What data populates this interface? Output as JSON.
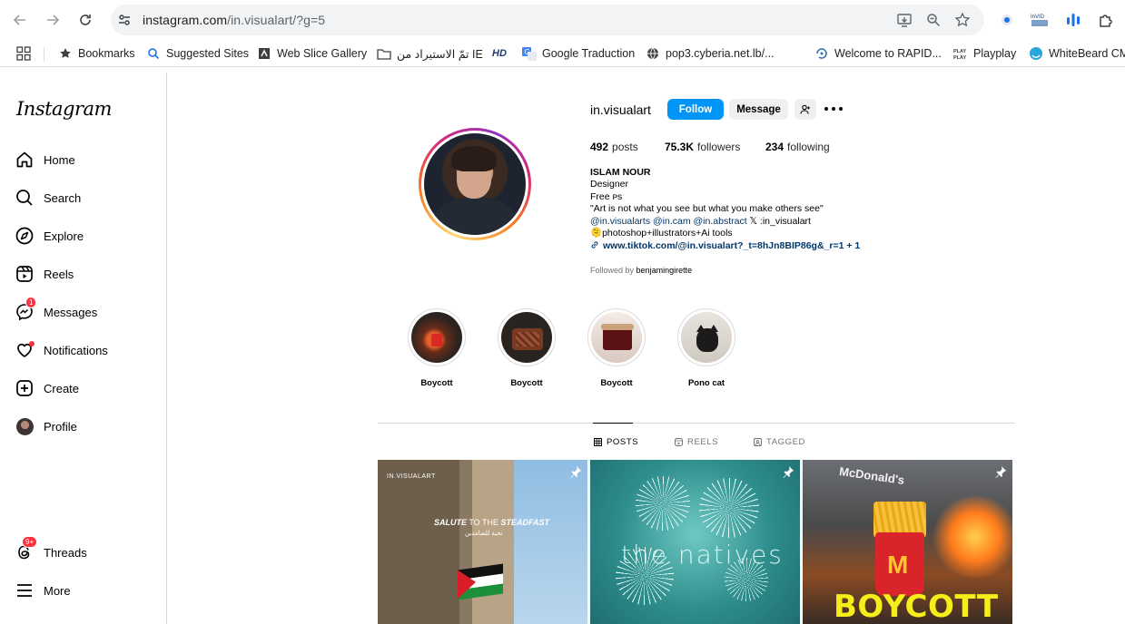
{
  "browser": {
    "url_host": "instagram.com",
    "url_path": "/in.visualart/?g=5"
  },
  "bookmarks": [
    {
      "label": "Bookmarks",
      "icon": "star-icon"
    },
    {
      "label": "Suggested Sites",
      "icon": "search-icon"
    },
    {
      "label": "Web Slice Gallery",
      "icon": "web-slice-icon"
    },
    {
      "label": "تمّ الاستيراد من IE",
      "icon": "folder-icon"
    },
    {
      "label": "HD",
      "icon": "hd-icon"
    },
    {
      "label": "Google Traduction",
      "icon": "translate-icon"
    },
    {
      "label": "pop3.cyberia.net.lb/...",
      "icon": "globe-icon"
    },
    {
      "label": "Welcome to RAPID...",
      "icon": "rapid-icon"
    },
    {
      "label": "Playplay",
      "icon": "playplay-icon"
    },
    {
      "label": "WhiteBeard CM",
      "icon": "whitebeard-icon"
    }
  ],
  "sidebar": {
    "logo": "Instagram",
    "items": [
      {
        "label": "Home",
        "icon": "home-icon"
      },
      {
        "label": "Search",
        "icon": "search-icon"
      },
      {
        "label": "Explore",
        "icon": "compass-icon"
      },
      {
        "label": "Reels",
        "icon": "reels-icon"
      },
      {
        "label": "Messages",
        "icon": "messenger-icon",
        "badge": "1"
      },
      {
        "label": "Notifications",
        "icon": "heart-icon"
      },
      {
        "label": "Create",
        "icon": "plus-square-icon"
      },
      {
        "label": "Profile",
        "icon": "avatar"
      },
      {
        "label": "Threads",
        "icon": "threads-icon",
        "badge": "9+"
      },
      {
        "label": "More",
        "icon": "hamburger-icon"
      }
    ]
  },
  "profile": {
    "username": "in.visualart",
    "follow_label": "Follow",
    "message_label": "Message",
    "stats": {
      "posts_count": "492",
      "posts_label": "posts",
      "followers_count": "75.3K",
      "followers_label": "followers",
      "following_count": "234",
      "following_label": "following"
    },
    "name": "ISLAM NOUR",
    "category": "Designer",
    "bio_line1": "Free ᴘs",
    "bio_line2": "\"Art is not what you see but what you make others see\"",
    "bio_line3_mentions": "@in.visualarts @in.cam @in.abstract",
    "bio_line3_x": "𝕏 :in_visualart",
    "bio_line4": "🫠photoshop+illustrators+Ai tools",
    "link": "www.tiktok.com/@in.visualart?_t=8hJn8BIP86g&_r=1 + 1",
    "followed_by_prefix": "Followed by",
    "followed_by_user": "benjamingirette"
  },
  "highlights": [
    {
      "label": "Boycott"
    },
    {
      "label": "Boycott"
    },
    {
      "label": "Boycott"
    },
    {
      "label": "Pono cat"
    }
  ],
  "tabs": [
    {
      "label": "POSTS",
      "icon": "grid-icon",
      "active": true
    },
    {
      "label": "REELS",
      "icon": "reels-icon",
      "active": false
    },
    {
      "label": "TAGGED",
      "icon": "tagged-icon",
      "active": false
    }
  ],
  "posts": [
    {
      "brand": "IN.VISUALART",
      "title_a": "SALUTE",
      "title_b": " TO THE ",
      "title_c": "STEADFAST",
      "subtitle": "تحية للصامدين"
    },
    {
      "text": "the natives"
    },
    {
      "sign": "McDonald's",
      "logo": "M",
      "caption": "BOYCOTT"
    }
  ]
}
